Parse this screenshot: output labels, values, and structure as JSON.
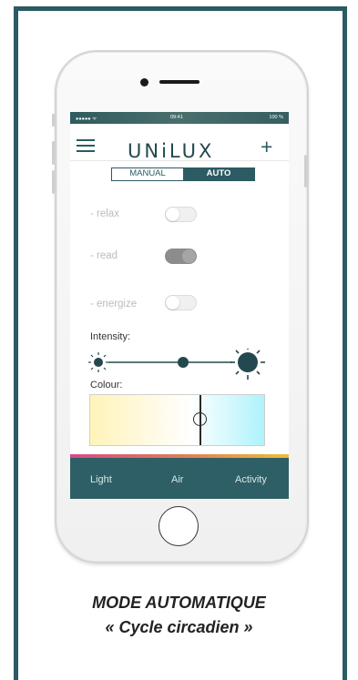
{
  "status_bar": {
    "signal": "●●●●● ᯤ",
    "time": "09:41",
    "battery": "100 %"
  },
  "header": {
    "logo": "UNiLUX",
    "add_symbol": "+"
  },
  "mode_switch": {
    "manual": "MANUAL",
    "auto": "AUTO",
    "selected": "AUTO"
  },
  "modes": [
    {
      "label": "- relax",
      "on": false
    },
    {
      "label": "- read",
      "on": true
    },
    {
      "label": "- energize",
      "on": false
    }
  ],
  "intensity": {
    "label": "Intensity:",
    "level": 0.5
  },
  "colour": {
    "label": "Colour:",
    "position": 0.62
  },
  "tabs": {
    "light": "Light",
    "air": "Air",
    "activity": "Activity"
  },
  "caption": {
    "line1": "MODE AUTOMATIQUE",
    "line2": "« Cycle circadien »"
  },
  "colors": {
    "frame": "#2b5b63",
    "accent_start": "#d94a86",
    "accent_end": "#eebb3a"
  }
}
